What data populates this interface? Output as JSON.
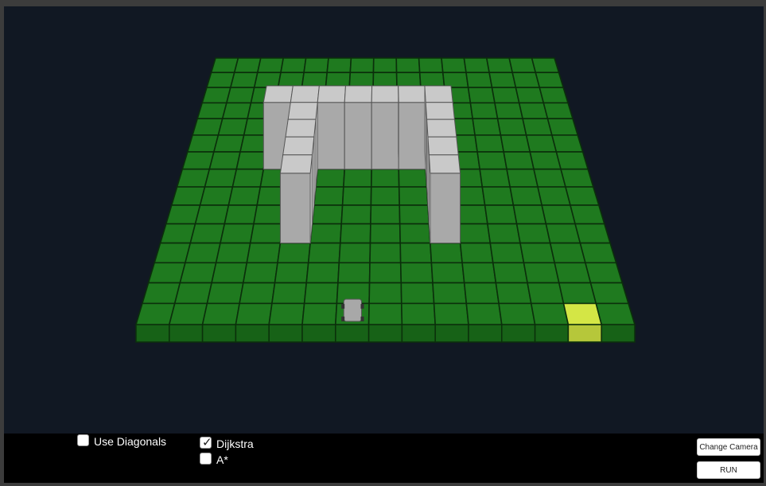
{
  "colors": {
    "tile_top": "#1f7a1f",
    "tile_side": "#176217",
    "goal": "#d4e645",
    "goal_side": "#b6c73a",
    "wall_top": "#c9c9c9",
    "wall_side": "#a9a9a9",
    "agent": "#a8a8a8",
    "background": "#111823"
  },
  "grid": {
    "columns": 15,
    "rows": 15
  },
  "goal": {
    "col": 13,
    "row": 14
  },
  "agent": {
    "col": 6,
    "row": 14
  },
  "walls": [
    {
      "col": 3,
      "row": 6
    },
    {
      "col": 4,
      "row": 6
    },
    {
      "col": 5,
      "row": 6
    },
    {
      "col": 6,
      "row": 6
    },
    {
      "col": 7,
      "row": 6
    },
    {
      "col": 8,
      "row": 6
    },
    {
      "col": 9,
      "row": 6
    },
    {
      "col": 4,
      "row": 7
    },
    {
      "col": 9,
      "row": 7
    },
    {
      "col": 4,
      "row": 8
    },
    {
      "col": 9,
      "row": 8
    },
    {
      "col": 4,
      "row": 9
    },
    {
      "col": 9,
      "row": 9
    },
    {
      "col": 4,
      "row": 10
    },
    {
      "col": 9,
      "row": 10
    }
  ],
  "options": {
    "use_diagonals": {
      "label": "Use Diagonals",
      "checked": false
    },
    "dijkstra": {
      "label": "Dijkstra",
      "checked": true
    },
    "astar": {
      "label": "A*",
      "checked": false
    }
  },
  "buttons": {
    "change_camera": "Change Camera",
    "run": "RUN"
  }
}
